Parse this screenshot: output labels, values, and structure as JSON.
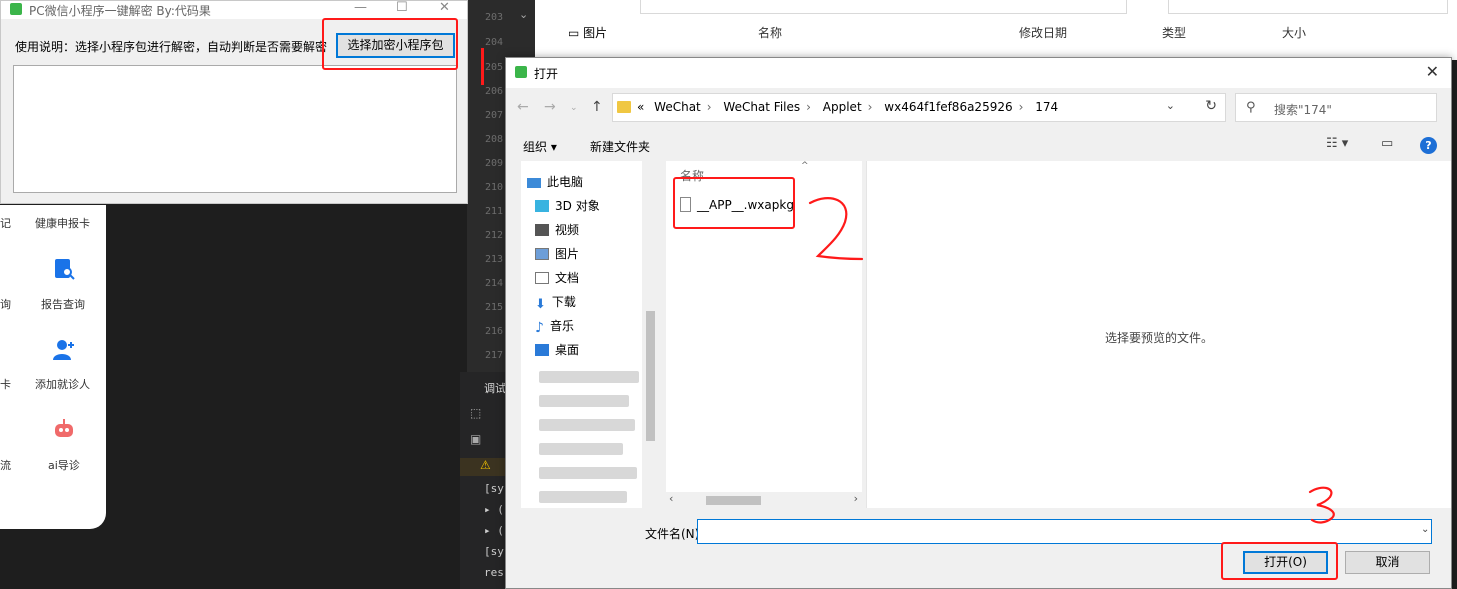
{
  "background": {
    "explorer": {
      "columns": [
        "名称",
        "修改日期",
        "类型",
        "大小"
      ],
      "nav_item": "图片"
    },
    "editor_line_numbers": [
      "203",
      "204",
      "205",
      "206",
      "207",
      "208",
      "209",
      "210",
      "211",
      "212",
      "213",
      "214",
      "215",
      "216",
      "217"
    ],
    "console": {
      "tab_label": "调试",
      "lines": [
        "[sy",
        "▸ (",
        "▸ (",
        "[sy",
        "res"
      ]
    },
    "miniprogram": {
      "items": [
        "健康申报卡",
        "报告查询",
        "添加就诊人",
        "ai导诊"
      ],
      "left_cut_items": [
        "记",
        "询",
        "卡",
        "流"
      ],
      "accent": "#1a73e8"
    }
  },
  "tool_window": {
    "title": "PC微信小程序一键解密 By:代码果",
    "usage_text": "使用说明：选择小程序包进行解密，自动判断是否需要解密",
    "choose_button": "选择加密小程序包",
    "log_text": ""
  },
  "open_dialog": {
    "title": "打开",
    "breadcrumb": [
      "«",
      "WeChat",
      "WeChat Files",
      "Applet",
      "wx464f1fef86a25926",
      "174"
    ],
    "search_placeholder": "搜索\"174\"",
    "organize": "组织 ▾",
    "new_folder": "新建文件夹",
    "nav_items": [
      {
        "label": "此电脑",
        "icon": "computer-icon"
      },
      {
        "label": "3D 对象",
        "icon": "cube-icon"
      },
      {
        "label": "视频",
        "icon": "video-icon"
      },
      {
        "label": "图片",
        "icon": "picture-icon"
      },
      {
        "label": "文档",
        "icon": "document-icon"
      },
      {
        "label": "下载",
        "icon": "download-icon"
      },
      {
        "label": "音乐",
        "icon": "music-icon"
      },
      {
        "label": "桌面",
        "icon": "desktop-icon"
      }
    ],
    "file_column_header": "名称",
    "files": [
      {
        "name": "__APP__.wxapkg",
        "icon": "file-icon"
      }
    ],
    "preview_message": "选择要预览的文件。",
    "filename_label": "文件名(N):",
    "filename_value": "",
    "open_button": "打开(O)",
    "cancel_button": "取消",
    "accent": "#0078d7"
  },
  "annotations": {
    "color": "#ff1a1a",
    "step_numbers": [
      "2",
      "3"
    ]
  }
}
